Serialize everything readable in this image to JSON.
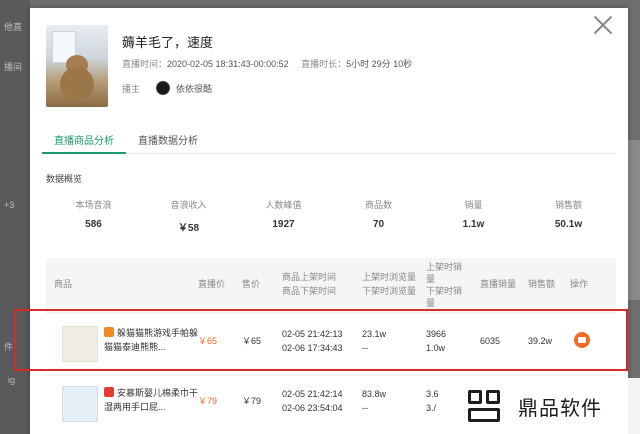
{
  "background": {
    "left_labels": [
      "他直",
      "播间",
      "+3",
      "件",
      "ig"
    ]
  },
  "live": {
    "title": "薅羊毛了，速度",
    "time_label": "直播时间：",
    "time_value": "2020-02-05 18:31:43-00:00:52",
    "duration_label": "直播时长：",
    "duration_value": "5小时 29分 10秒",
    "host_label": "播主",
    "host_name": "依依很酷"
  },
  "tabs": [
    {
      "label": "直播商品分析",
      "active": true
    },
    {
      "label": "直播数据分析",
      "active": false
    }
  ],
  "overview": {
    "title": "数据概览",
    "stats": [
      {
        "key": "本场音浪",
        "value": "586"
      },
      {
        "key": "音浪收入",
        "value": "￥58"
      },
      {
        "key": "人数峰值",
        "value": "1927"
      },
      {
        "key": "商品数",
        "value": "70"
      },
      {
        "key": "销量",
        "value": "1.1w"
      },
      {
        "key": "销售额",
        "value": "50.1w"
      }
    ]
  },
  "table": {
    "headers": {
      "product": "商品",
      "live_price": "直播价",
      "price": "售价",
      "time_on": "商品上架时间",
      "time_off": "商品下架时间",
      "views_on": "上架时浏览量",
      "views_off": "下架时浏览量",
      "sales_on_1": "上架时销",
      "sales_on_2": "量",
      "sales_off": "下架时销",
      "sales_off_2": "量",
      "live_sales": "直播销量",
      "revenue": "销售额",
      "op": "操作"
    },
    "rows": [
      {
        "name": "躲猫猫熊游戏手帕躲猫猫泰迪熊熊...",
        "shop": "tmall",
        "live_price": "￥65",
        "price": "￥65",
        "time_on": "02-05 21:42:13",
        "time_off": "02-06 17:34:43",
        "views_on": "23.1w",
        "views_off": "--",
        "sales_on": "3966",
        "sales_off": "1.0w",
        "live_sales": "6035",
        "revenue": "39.2w"
      },
      {
        "name": "安慕斯婴儿棉柔巾干湿两用手口屁...",
        "shop": "red",
        "live_price": "￥79",
        "price": "￥79",
        "time_on": "02-05 21:42:14",
        "time_off": "02-06 23:54:04",
        "views_on": "83.8w",
        "views_off": "--",
        "sales_on": "3.6",
        "sales_off": "3./",
        "live_sales": "",
        "revenue": ""
      }
    ]
  },
  "watermark": {
    "text": "鼎品软件"
  }
}
